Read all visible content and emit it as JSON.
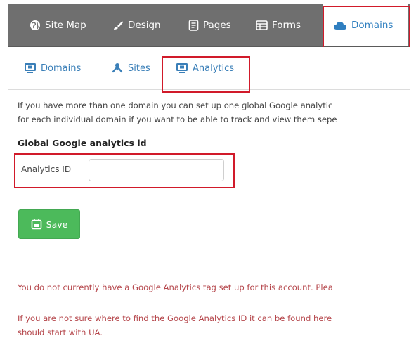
{
  "top_nav": {
    "items": [
      {
        "label": "Site Map",
        "icon": "globe-icon"
      },
      {
        "label": "Design",
        "icon": "brush-icon"
      },
      {
        "label": "Pages",
        "icon": "page-icon"
      },
      {
        "label": "Forms",
        "icon": "form-icon"
      },
      {
        "label": "Domains",
        "icon": "cloud-icon",
        "active": true
      }
    ]
  },
  "sub_nav": {
    "items": [
      {
        "label": "Domains",
        "icon": "monitor-icon"
      },
      {
        "label": "Sites",
        "icon": "sitemap-icon"
      },
      {
        "label": "Analytics",
        "icon": "monitor-icon",
        "active": true
      }
    ]
  },
  "content": {
    "intro_line1": "If you have more than one domain you can set up one global Google analytic",
    "intro_line2": "for each individual domain if you want to be able to track and view them sepe",
    "section_title": "Global Google analytics id",
    "field_label": "Analytics ID",
    "field_value": "",
    "save_label": "Save",
    "warning1": "You do not currently have a Google Analytics tag set up for this account. Plea",
    "warning2_line1": "If you are not sure where to find the Google Analytics ID it can be found here",
    "warning2_line2": "should start with UA."
  },
  "colors": {
    "nav_bg": "#6f6f6f",
    "link": "#3a7fb8",
    "highlight": "#d11a2a",
    "save_green": "#4cba5b",
    "warning_text": "#b5464b"
  }
}
